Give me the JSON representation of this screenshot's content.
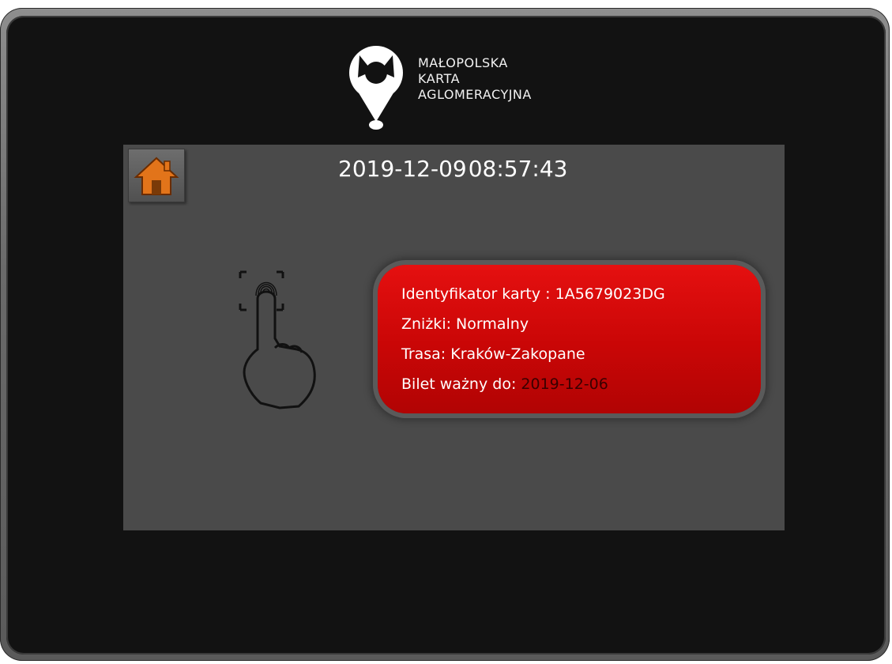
{
  "logo": {
    "line1": "MAŁOPOLSKA",
    "line2": "KARTA",
    "line3": "AGLOMERACYJNA"
  },
  "header": {
    "date": "2019-12-09",
    "time": "08:57:43"
  },
  "card": {
    "id_label": "Identyfikator karty :",
    "id_value": "1A5679023DG",
    "discount_label": "Zniżki:",
    "discount_value": "Normalny",
    "route_label": "Trasa:",
    "route_value": "Kraków-Zakopane",
    "valid_label": "Bilet ważny do:",
    "valid_value": "2019-12-06"
  },
  "icons": {
    "home": "home-icon",
    "fingerprint": "fingerprint-touch-icon",
    "logo": "pin-logo-icon"
  },
  "colors": {
    "card_background": "#d40909",
    "panel_background": "#4a4a4a",
    "home_roof": "#e2741a",
    "expired_date": "#3a0000"
  }
}
